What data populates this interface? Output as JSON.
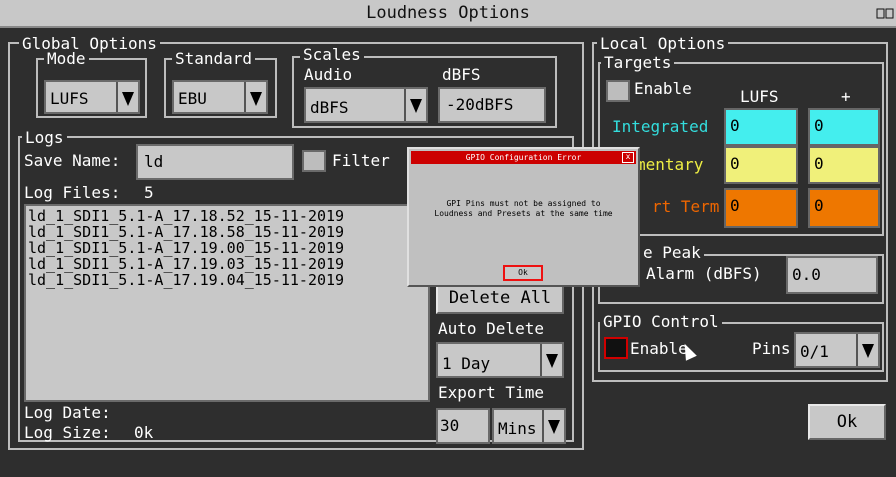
{
  "window": {
    "title": "Loudness Options",
    "corner_icon": "restore-icon"
  },
  "global": {
    "title": "Global Options",
    "mode": {
      "label": "Mode",
      "value": "LUFS"
    },
    "standard": {
      "label": "Standard",
      "value": "EBU"
    },
    "scales": {
      "label": "Scales",
      "audio_label": "Audio",
      "audio_value": "dBFS",
      "dbfs_label": "dBFS",
      "dbfs_value": "-20dBFS"
    }
  },
  "logs": {
    "title": "Logs",
    "save_name_label": "Save Name:",
    "save_name_value": "ld",
    "filter_label": "Filter",
    "log_files_label": "Log Files:",
    "log_files_count": "5",
    "files": [
      "ld_1_SDI1_5.1-A_17.18.52_15-11-2019",
      "ld_1_SDI1_5.1-A_17.18.58_15-11-2019",
      "ld_1_SDI1_5.1-A_17.19.00_15-11-2019",
      "ld_1_SDI1_5.1-A_17.19.03_15-11-2019",
      "ld_1_SDI1_5.1-A_17.19.04_15-11-2019"
    ],
    "delete_all": "Delete All",
    "auto_delete_label": "Auto Delete",
    "auto_delete_value": "1 Day",
    "export_time_label": "Export Time",
    "export_value": "30",
    "export_unit": "Mins",
    "log_date_label": "Log Date:",
    "log_size_label": "Log Size:",
    "log_size_value": "0k"
  },
  "local": {
    "title": "Local Options",
    "targets": {
      "title": "Targets",
      "enable_label": "Enable",
      "col_lufs": "LUFS",
      "col_plus": "+",
      "rows": [
        {
          "label": "Integrated",
          "lufs": "0",
          "plus": "0",
          "color": "#44eeee",
          "label_color": "#33dddd"
        },
        {
          "label": "mentary",
          "lufs": "0",
          "plus": "0",
          "color": "#f0f07a",
          "label_color": "#eeee44"
        },
        {
          "label": "rt Term",
          "lufs": "0",
          "plus": "0",
          "color": "#ee7700",
          "label_color": "#ee6600"
        }
      ]
    },
    "peak": {
      "title": "e Peak",
      "alarm_label": "Alarm (dBFS)",
      "alarm_value": "0.0"
    },
    "gpio": {
      "title": "GPIO Control",
      "enable_label": "Enable",
      "pins_label": "Pins",
      "pins_value": "0/1"
    }
  },
  "ok_button": "Ok",
  "dialog": {
    "title": "GPIO Configuration Error",
    "close_glyph": "x",
    "message_line1": "GPI Pins must not be assigned to",
    "message_line2": "Loudness and Presets at the same time",
    "ok": "Ok"
  }
}
